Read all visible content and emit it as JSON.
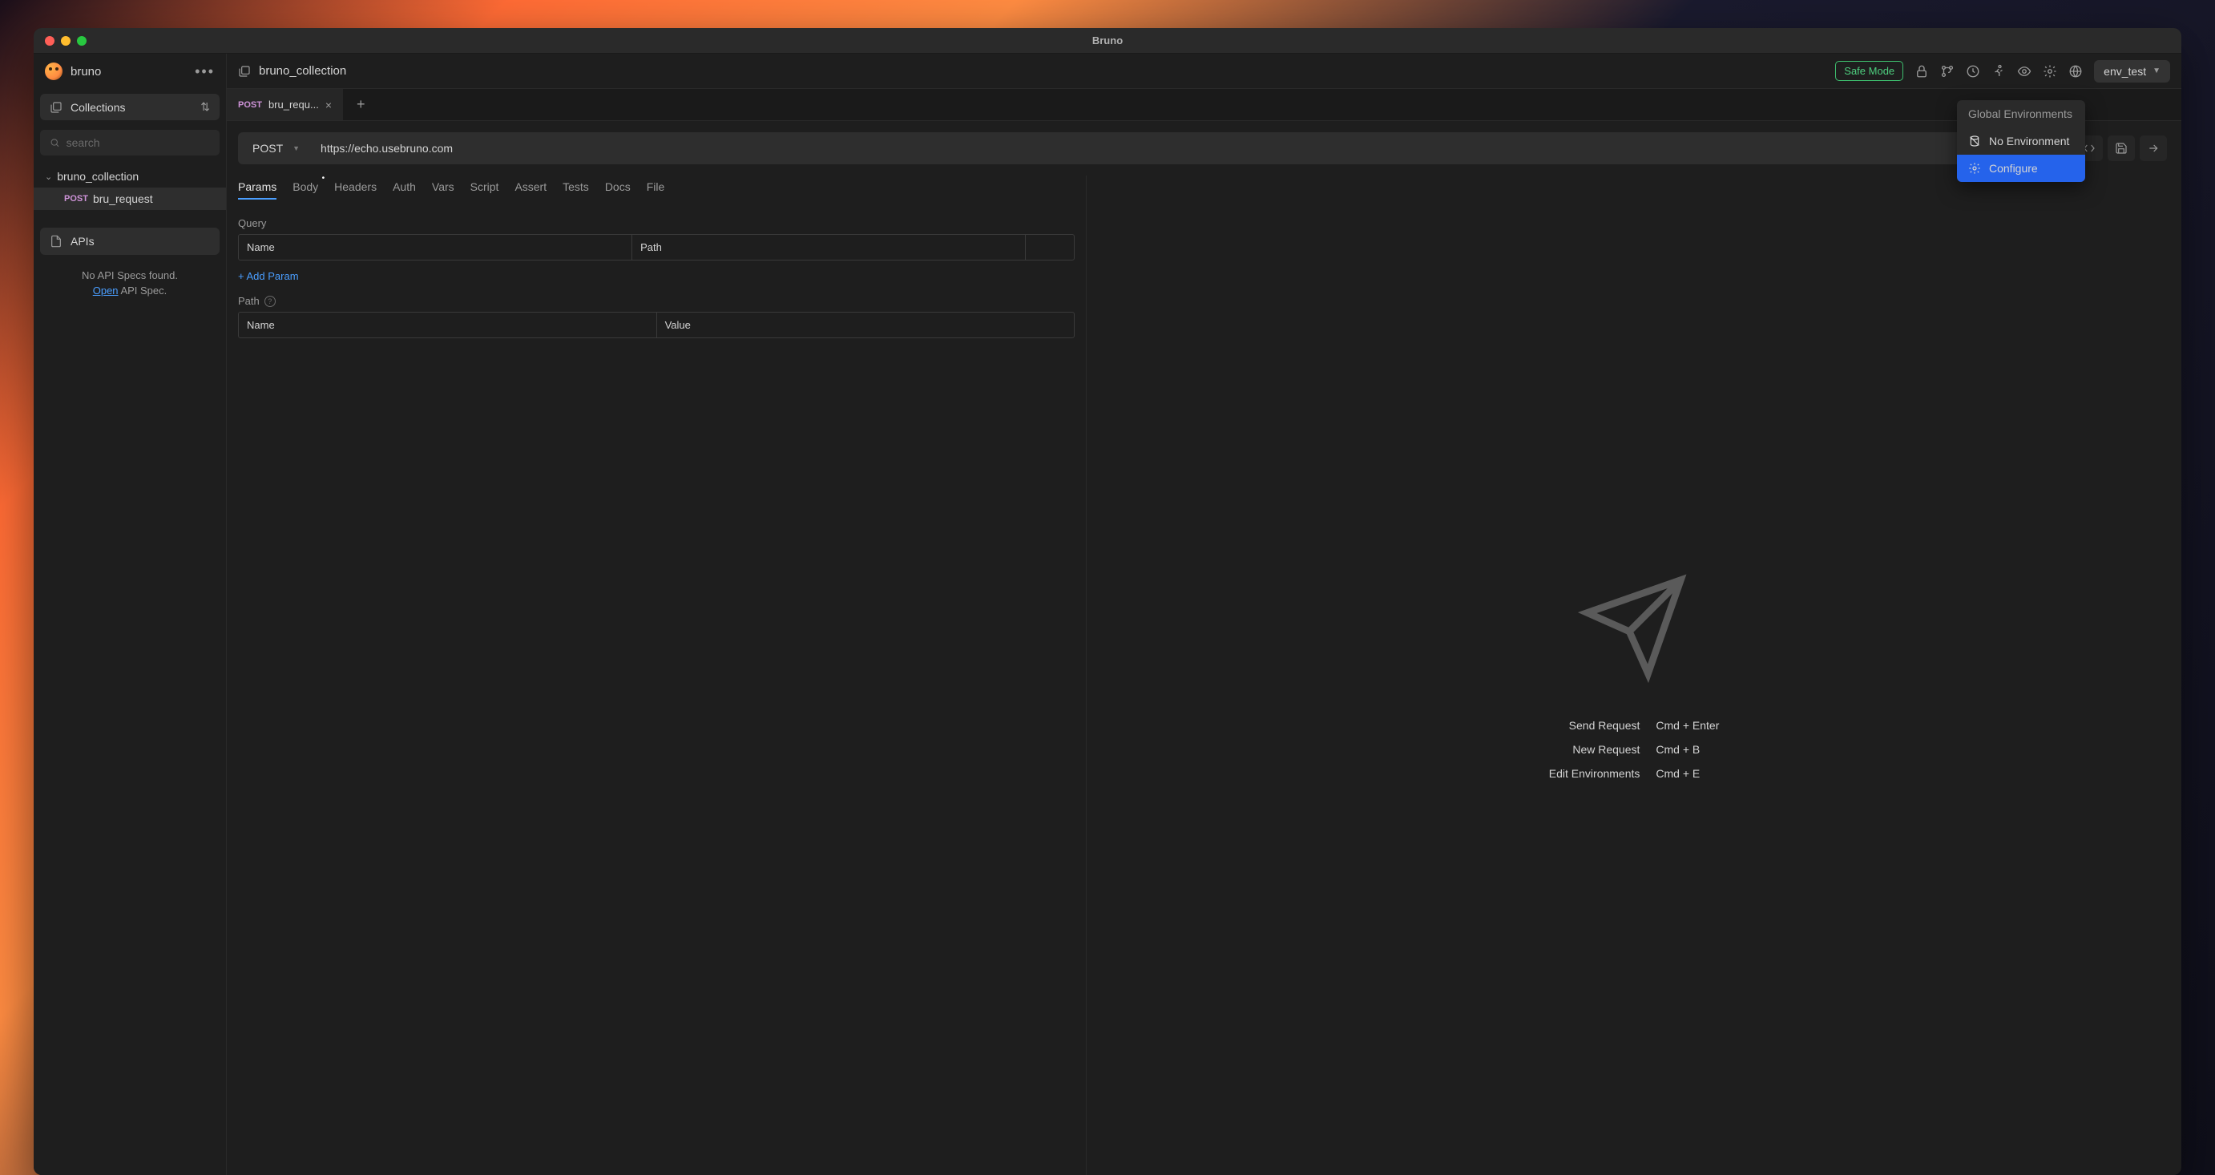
{
  "window": {
    "title": "Bruno"
  },
  "sidebar": {
    "app_name": "bruno",
    "collections_label": "Collections",
    "search_placeholder": "search",
    "tree": {
      "collection_name": "bruno_collection",
      "request_method": "POST",
      "request_name": "bru_request"
    },
    "apis_label": "APIs",
    "apis_empty_text": "No API Specs found.",
    "apis_open_link": "Open",
    "apis_open_suffix": " API Spec."
  },
  "topbar": {
    "breadcrumb": "bruno_collection",
    "safe_mode": "Safe Mode",
    "env_label": "env_test"
  },
  "tabs": {
    "method": "POST",
    "label": "bru_requ..."
  },
  "urlbar": {
    "method": "POST",
    "url": "https://echo.usebruno.com"
  },
  "request_tabs": {
    "params": "Params",
    "body": "Body",
    "headers": "Headers",
    "auth": "Auth",
    "vars": "Vars",
    "script": "Script",
    "assert": "Assert",
    "tests": "Tests",
    "docs": "Docs",
    "file": "File"
  },
  "params_section": {
    "query_label": "Query",
    "name_header": "Name",
    "path_header": "Path",
    "add_param": "+ Add Param",
    "path_label": "Path",
    "value_header": "Value"
  },
  "env_menu": {
    "header": "Global Environments",
    "no_env": "No Environment",
    "configure": "Configure"
  },
  "shortcuts": {
    "send_label": "Send Request",
    "send_key": "Cmd + Enter",
    "new_label": "New Request",
    "new_key": "Cmd + B",
    "edit_label": "Edit Environments",
    "edit_key": "Cmd + E"
  }
}
